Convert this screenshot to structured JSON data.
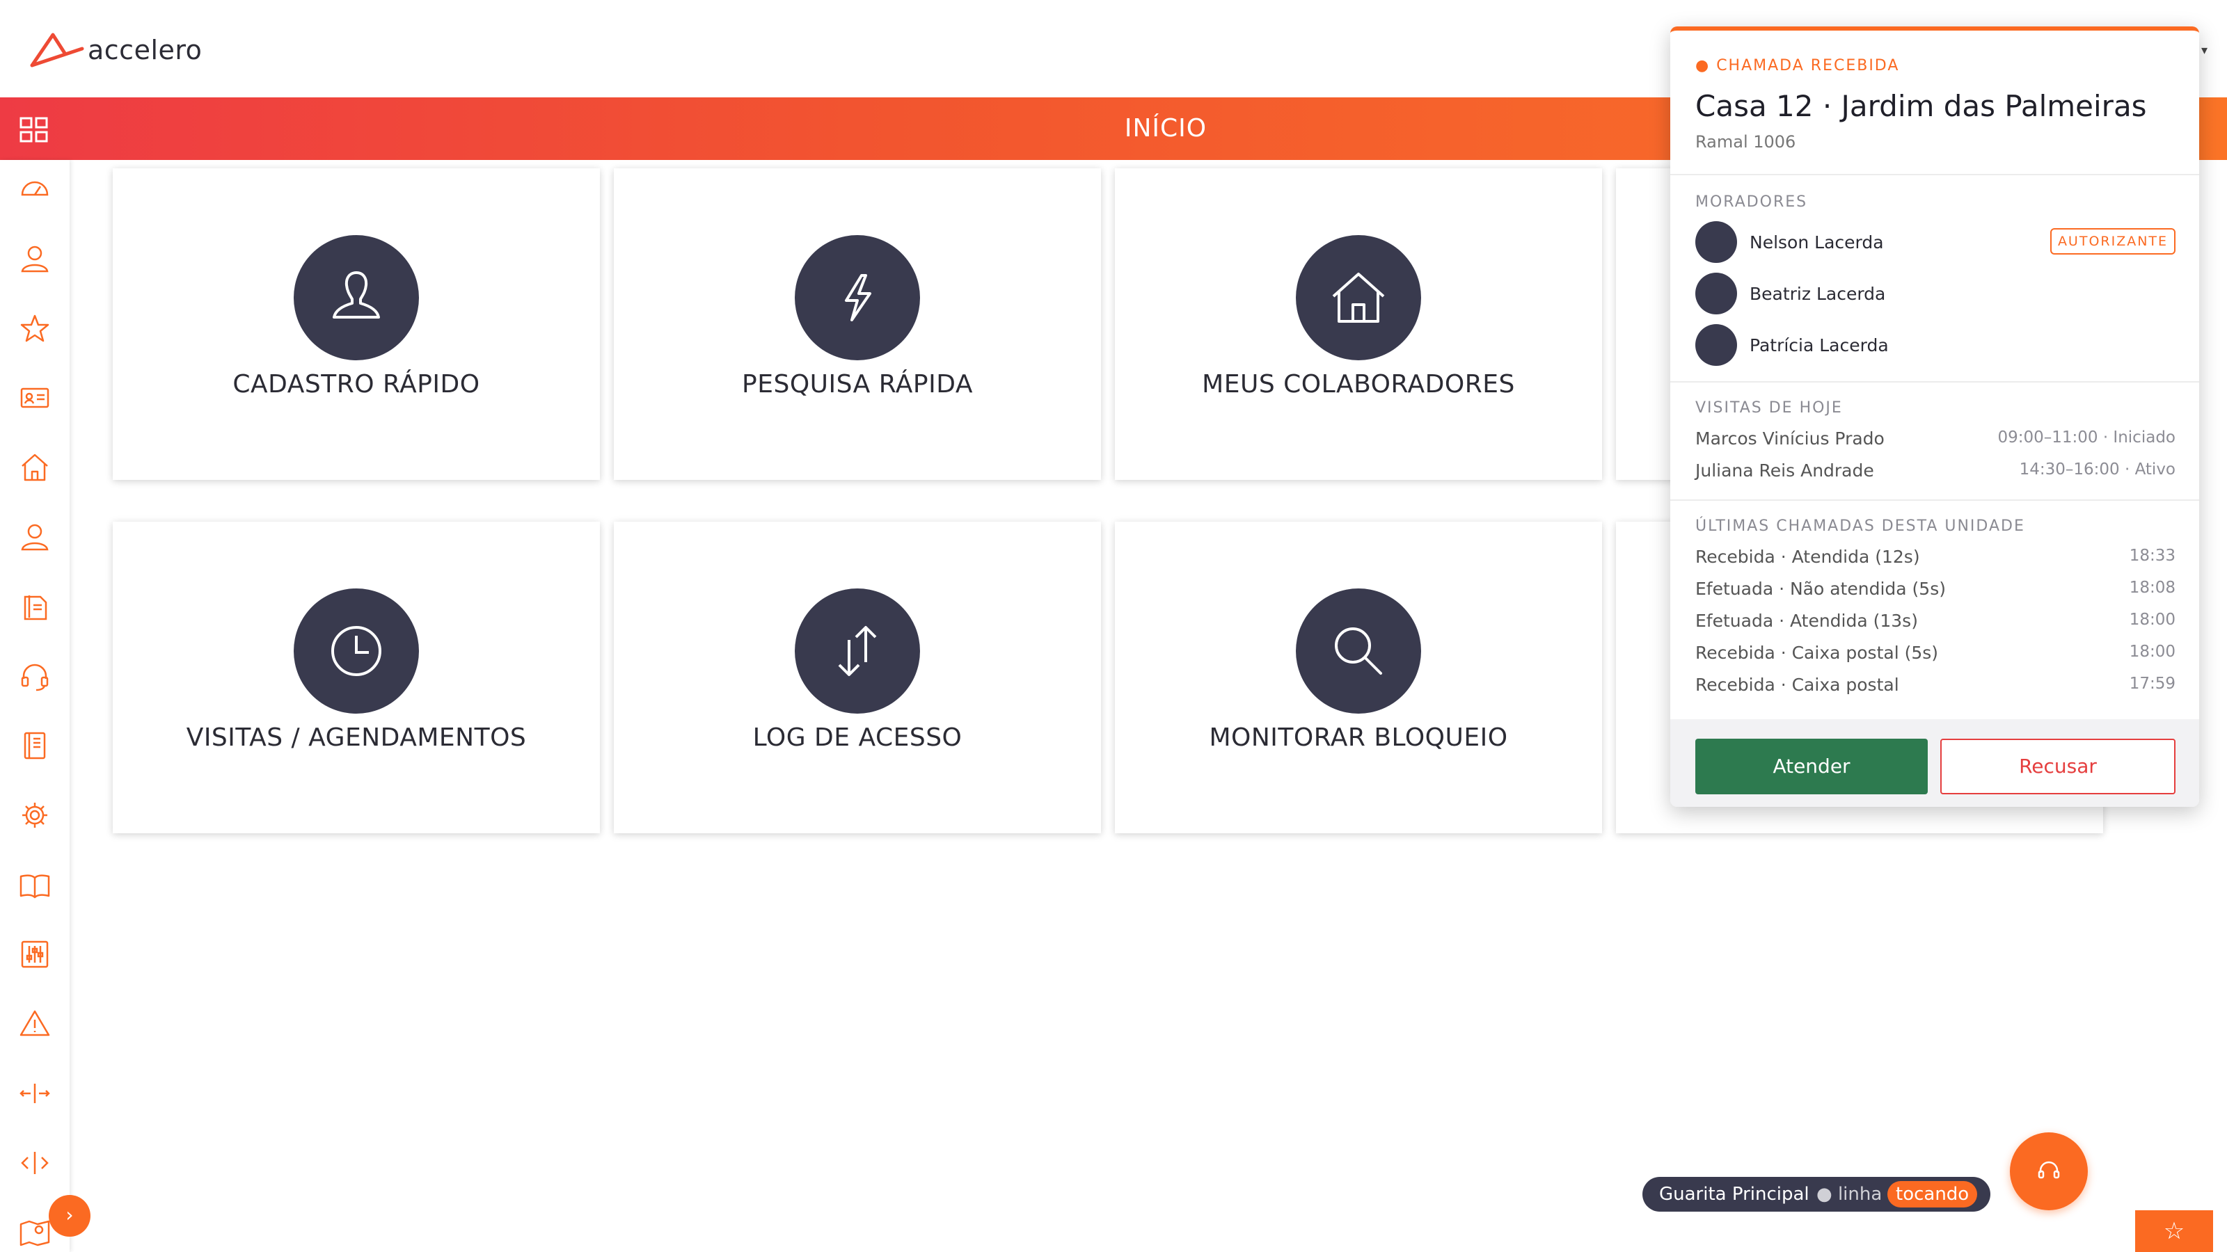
{
  "brand": {
    "name": "accelero",
    "accent": "#fb6a22",
    "dark": "#393a4e"
  },
  "header": {
    "title": "INÍCIO"
  },
  "sidebar": {
    "icons": [
      "dashboard-icon",
      "user-icon",
      "star-icon",
      "id-card-icon",
      "home-icon",
      "person-icon",
      "document-icon",
      "headset-icon",
      "notebook-icon",
      "gear-icon",
      "book-icon",
      "sliders-icon",
      "warning-icon",
      "arrows-horizontal-icon",
      "code-icon",
      "map-pin-icon"
    ],
    "expand_label": "›"
  },
  "cards": [
    {
      "label": "CADASTRO RÁPIDO",
      "icon": "user-icon"
    },
    {
      "label": "PESQUISA RÁPIDA",
      "icon": "bolt-icon"
    },
    {
      "label": "MEUS COLABORADORES",
      "icon": "house-icon"
    },
    {
      "label": "VISITAS / AGENDAMENTOS",
      "icon": "clock-icon"
    },
    {
      "label": "LOG DE ACESSO",
      "icon": "transfer-arrows-icon"
    },
    {
      "label": "MONITORAR BLOQUEIO",
      "icon": "search-icon"
    }
  ],
  "call": {
    "kicker": "● CHAMADA RECEBIDA",
    "title": "Casa 12 · Jardim das Palmeiras",
    "extension": "Ramal 1006",
    "residents_title": "MORADORES",
    "residents": [
      {
        "name": "Nelson Lacerda",
        "badge": "AUTORIZANTE"
      },
      {
        "name": "Beatriz Lacerda",
        "badge": ""
      },
      {
        "name": "Patrícia Lacerda",
        "badge": ""
      }
    ],
    "visits_title": "VISITAS DE HOJE",
    "visits": [
      {
        "name": "Marcos Vinícius Prado",
        "info": "09:00–11:00 · Iniciado"
      },
      {
        "name": "Juliana Reis Andrade",
        "info": "14:30–16:00 · Ativo"
      }
    ],
    "calls_title": "ÚLTIMAS CHAMADAS DESTA UNIDADE",
    "calls": [
      {
        "desc": "Recebida · Atendida (12s)",
        "time": "18:33"
      },
      {
        "desc": "Efetuada · Não atendida (5s)",
        "time": "18:08"
      },
      {
        "desc": "Efetuada · Atendida (13s)",
        "time": "18:00"
      },
      {
        "desc": "Recebida · Caixa postal (5s)",
        "time": "18:00"
      },
      {
        "desc": "Recebida · Caixa postal",
        "time": "17:59"
      }
    ],
    "accept_label": "Atender",
    "reject_label": "Recusar"
  },
  "status": {
    "name": "Guarita Principal",
    "line": "● linha",
    "state": "tocando"
  },
  "favorites_label": "☆"
}
